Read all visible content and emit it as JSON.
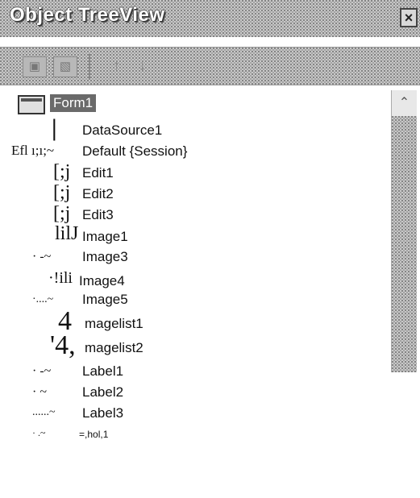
{
  "window": {
    "title": "Object TreeView",
    "close_glyph": "×"
  },
  "toolbar": {
    "btn1_icon": "new-object-icon",
    "btn2_icon": "delete-object-icon",
    "up_glyph": "↑",
    "down_glyph": "↓"
  },
  "tree": {
    "root": "Form1",
    "items": [
      {
        "glyph": "|",
        "label": "DataSource1"
      },
      {
        "glyph": "Efl  ı;ı;~",
        "label": "Default {Session}"
      },
      {
        "glyph": "[;j",
        "label": "Edit1"
      },
      {
        "glyph": "[;j",
        "label": "Edit2"
      },
      {
        "glyph": "[;j",
        "label": "Edit3"
      },
      {
        "glyph": "lilJ",
        "label": "Image1"
      },
      {
        "glyph": "·   -~",
        "label": "Image3"
      },
      {
        "glyph": "·!ili",
        "label": "Image4"
      },
      {
        "glyph": "·....~",
        "label": "Image5"
      },
      {
        "glyph": "4",
        "label": "magelist1"
      },
      {
        "glyph": "'4,",
        "label": "magelist2"
      },
      {
        "glyph": "·   -~",
        "label": "Label1"
      },
      {
        "glyph": "·   ~",
        "label": "Label2"
      },
      {
        "glyph": "......~",
        "label": "Label3"
      },
      {
        "glyph": "·  .~",
        "label": "=,hol,1"
      }
    ]
  },
  "scrollbar": {
    "up_glyph": "⌃"
  }
}
